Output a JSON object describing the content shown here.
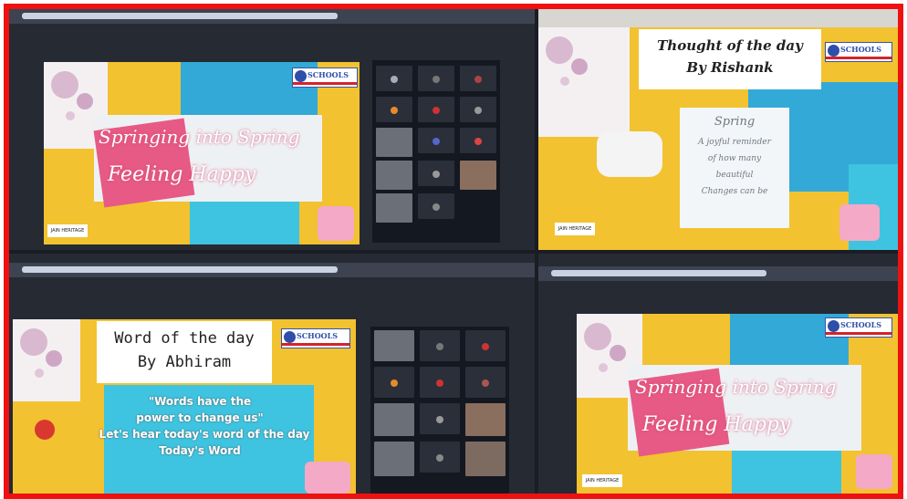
{
  "image_kind": "photo collage of video-call screens",
  "colors": {
    "border": "#ee1111",
    "slide_yellow": "#f2c230",
    "slide_blue": "#33a9d8",
    "slide_teal": "#3ec4e0"
  },
  "logo": {
    "name": "SCHOOLS",
    "icon": "school-globe-icon"
  },
  "jain_label": "JAIN HERITAGE",
  "panels": [
    {
      "id": "top-left",
      "headline_line1": "Springing into Spring",
      "headline_line2": "Feeling Happy"
    },
    {
      "id": "top-right",
      "title_line1": "Thought of the day",
      "title_line2": "By Rishank",
      "card_heading": "Spring",
      "card_line1": "A joyful reminder",
      "card_line2": "of how many",
      "card_line3": "beautiful",
      "card_line4": "Changes can be"
    },
    {
      "id": "bottom-left",
      "title_line1": "Word of the day",
      "title_line2": "By Abhiram",
      "quote_line1": "\"Words have the",
      "quote_line2": "power to change us\"",
      "quote_line3": "Let's hear today's word of the day",
      "quote_line4": "Today's Word"
    },
    {
      "id": "bottom-right",
      "headline_line1": "Springing into Spring",
      "headline_line2": "Feeling Happy"
    }
  ]
}
